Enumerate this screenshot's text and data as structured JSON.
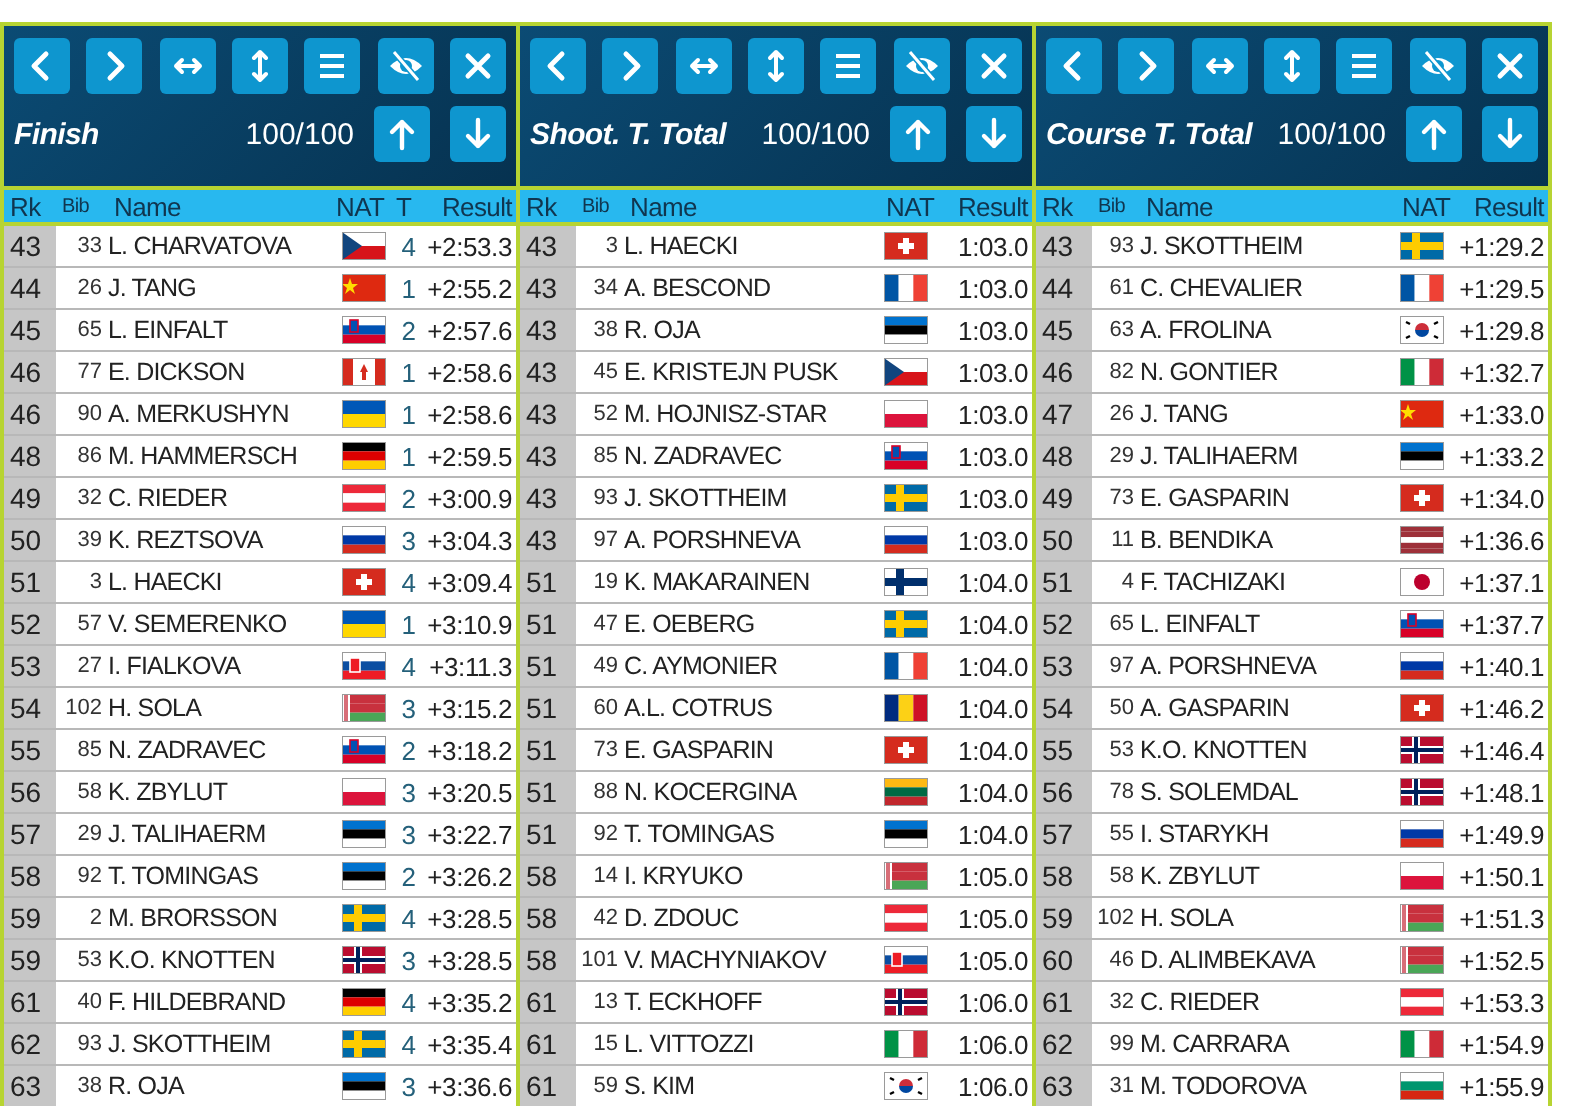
{
  "panels": [
    {
      "title": "Finish",
      "count": "100/100",
      "columns": [
        "Rk",
        "Bib",
        "Name",
        "NAT",
        "T",
        "Result"
      ],
      "rows": [
        {
          "rank": "43",
          "bib": "33",
          "name": "L. CHARVATOVA",
          "kind": "cze",
          "shots": "4",
          "result": "+2:53.3"
        },
        {
          "rank": "44",
          "bib": "26",
          "name": "J. TANG",
          "kind": "chn",
          "shots": "1",
          "result": "+2:55.2"
        },
        {
          "rank": "45",
          "bib": "65",
          "name": "L. EINFALT",
          "kind": "slo",
          "shots": "2",
          "result": "+2:57.6"
        },
        {
          "rank": "46",
          "bib": "77",
          "name": "E. DICKSON",
          "kind": "can",
          "shots": "1",
          "result": "+2:58.6"
        },
        {
          "rank": "46",
          "bib": "90",
          "name": "A. MERKUSHYN",
          "kind": "ukr",
          "shots": "1",
          "result": "+2:58.6"
        },
        {
          "rank": "48",
          "bib": "86",
          "name": "M. HAMMERSCH",
          "kind": "ger",
          "shots": "1",
          "result": "+2:59.5"
        },
        {
          "rank": "49",
          "bib": "32",
          "name": "C. RIEDER",
          "kind": "aut",
          "shots": "2",
          "result": "+3:00.9"
        },
        {
          "rank": "50",
          "bib": "39",
          "name": "K. REZTSOVA",
          "kind": "rus",
          "shots": "3",
          "result": "+3:04.3"
        },
        {
          "rank": "51",
          "bib": "3",
          "name": "L. HAECKI",
          "kind": "sui",
          "shots": "4",
          "result": "+3:09.4"
        },
        {
          "rank": "52",
          "bib": "57",
          "name": "V. SEMERENKO",
          "kind": "ukr",
          "shots": "1",
          "result": "+3:10.9"
        },
        {
          "rank": "53",
          "bib": "27",
          "name": "I. FIALKOVA",
          "kind": "svk",
          "shots": "4",
          "result": "+3:11.3"
        },
        {
          "rank": "54",
          "bib": "102",
          "name": "H. SOLA",
          "kind": "blr",
          "shots": "3",
          "result": "+3:15.2"
        },
        {
          "rank": "55",
          "bib": "85",
          "name": "N. ZADRAVEC",
          "kind": "slo",
          "shots": "2",
          "result": "+3:18.2"
        },
        {
          "rank": "56",
          "bib": "58",
          "name": "K. ZBYLUT",
          "kind": "pol",
          "shots": "3",
          "result": "+3:20.5"
        },
        {
          "rank": "57",
          "bib": "29",
          "name": "J. TALIHAERM",
          "kind": "est",
          "shots": "3",
          "result": "+3:22.7"
        },
        {
          "rank": "58",
          "bib": "92",
          "name": "T. TOMINGAS",
          "kind": "est",
          "shots": "2",
          "result": "+3:26.2"
        },
        {
          "rank": "59",
          "bib": "2",
          "name": "M. BRORSSON",
          "kind": "swe",
          "shots": "4",
          "result": "+3:28.5"
        },
        {
          "rank": "59",
          "bib": "53",
          "name": "K.O. KNOTTEN",
          "kind": "nor",
          "shots": "3",
          "result": "+3:28.5"
        },
        {
          "rank": "61",
          "bib": "40",
          "name": "F. HILDEBRAND",
          "kind": "ger",
          "shots": "4",
          "result": "+3:35.2"
        },
        {
          "rank": "62",
          "bib": "93",
          "name": "J. SKOTTHEIM",
          "kind": "swe",
          "shots": "4",
          "result": "+3:35.4"
        },
        {
          "rank": "63",
          "bib": "38",
          "name": "R. OJA",
          "kind": "est",
          "shots": "3",
          "result": "+3:36.6"
        }
      ]
    },
    {
      "title": "Shoot. T. Total",
      "count": "100/100",
      "columns": [
        "Rk",
        "Bib",
        "Name",
        "NAT",
        "Result"
      ],
      "rows": [
        {
          "rank": "43",
          "bib": "3",
          "name": "L. HAECKI",
          "kind": "sui",
          "result": "1:03.0"
        },
        {
          "rank": "43",
          "bib": "34",
          "name": "A. BESCOND",
          "kind": "fra",
          "result": "1:03.0"
        },
        {
          "rank": "43",
          "bib": "38",
          "name": "R. OJA",
          "kind": "est",
          "result": "1:03.0"
        },
        {
          "rank": "43",
          "bib": "45",
          "name": "E. KRISTEJN PUSK",
          "kind": "cze",
          "result": "1:03.0"
        },
        {
          "rank": "43",
          "bib": "52",
          "name": "M. HOJNISZ-STAR",
          "kind": "pol",
          "result": "1:03.0"
        },
        {
          "rank": "43",
          "bib": "85",
          "name": "N. ZADRAVEC",
          "kind": "slo",
          "result": "1:03.0"
        },
        {
          "rank": "43",
          "bib": "93",
          "name": "J. SKOTTHEIM",
          "kind": "swe",
          "result": "1:03.0"
        },
        {
          "rank": "43",
          "bib": "97",
          "name": "A. PORSHNEVA",
          "kind": "rus",
          "result": "1:03.0"
        },
        {
          "rank": "51",
          "bib": "19",
          "name": "K. MAKARAINEN",
          "kind": "fin",
          "result": "1:04.0"
        },
        {
          "rank": "51",
          "bib": "47",
          "name": "E. OEBERG",
          "kind": "swe",
          "result": "1:04.0"
        },
        {
          "rank": "51",
          "bib": "49",
          "name": "C. AYMONIER",
          "kind": "fra",
          "result": "1:04.0"
        },
        {
          "rank": "51",
          "bib": "60",
          "name": "A.L. COTRUS",
          "kind": "rou",
          "result": "1:04.0"
        },
        {
          "rank": "51",
          "bib": "73",
          "name": "E. GASPARIN",
          "kind": "sui",
          "result": "1:04.0"
        },
        {
          "rank": "51",
          "bib": "88",
          "name": "N. KOCERGINA",
          "kind": "ltu",
          "result": "1:04.0"
        },
        {
          "rank": "51",
          "bib": "92",
          "name": "T. TOMINGAS",
          "kind": "est",
          "result": "1:04.0"
        },
        {
          "rank": "58",
          "bib": "14",
          "name": "I. KRYUKO",
          "kind": "blr",
          "result": "1:05.0"
        },
        {
          "rank": "58",
          "bib": "42",
          "name": "D. ZDOUC",
          "kind": "aut",
          "result": "1:05.0"
        },
        {
          "rank": "58",
          "bib": "101",
          "name": "V. MACHYNIAKOV",
          "kind": "svk",
          "result": "1:05.0"
        },
        {
          "rank": "61",
          "bib": "13",
          "name": "T. ECKHOFF",
          "kind": "nor",
          "result": "1:06.0"
        },
        {
          "rank": "61",
          "bib": "15",
          "name": "L. VITTOZZI",
          "kind": "ita",
          "result": "1:06.0"
        },
        {
          "rank": "61",
          "bib": "59",
          "name": "S. KIM",
          "kind": "kor",
          "result": "1:06.0"
        }
      ]
    },
    {
      "title": "Course T. Total",
      "count": "100/100",
      "columns": [
        "Rk",
        "Bib",
        "Name",
        "NAT",
        "Result"
      ],
      "rows": [
        {
          "rank": "43",
          "bib": "93",
          "name": "J. SKOTTHEIM",
          "kind": "swe",
          "result": "+1:29.2"
        },
        {
          "rank": "44",
          "bib": "61",
          "name": "C. CHEVALIER",
          "kind": "fra",
          "result": "+1:29.5"
        },
        {
          "rank": "45",
          "bib": "63",
          "name": "A. FROLINA",
          "kind": "kor",
          "result": "+1:29.8"
        },
        {
          "rank": "46",
          "bib": "82",
          "name": "N. GONTIER",
          "kind": "ita",
          "result": "+1:32.7"
        },
        {
          "rank": "47",
          "bib": "26",
          "name": "J. TANG",
          "kind": "chn",
          "result": "+1:33.0"
        },
        {
          "rank": "48",
          "bib": "29",
          "name": "J. TALIHAERM",
          "kind": "est",
          "result": "+1:33.2"
        },
        {
          "rank": "49",
          "bib": "73",
          "name": "E. GASPARIN",
          "kind": "sui",
          "result": "+1:34.0"
        },
        {
          "rank": "50",
          "bib": "11",
          "name": "B. BENDIKA",
          "kind": "lat",
          "result": "+1:36.6"
        },
        {
          "rank": "51",
          "bib": "4",
          "name": "F. TACHIZAKI",
          "kind": "jpn",
          "result": "+1:37.1"
        },
        {
          "rank": "52",
          "bib": "65",
          "name": "L. EINFALT",
          "kind": "slo",
          "result": "+1:37.7"
        },
        {
          "rank": "53",
          "bib": "97",
          "name": "A. PORSHNEVA",
          "kind": "rus",
          "result": "+1:40.1"
        },
        {
          "rank": "54",
          "bib": "50",
          "name": "A. GASPARIN",
          "kind": "sui",
          "result": "+1:46.2"
        },
        {
          "rank": "55",
          "bib": "53",
          "name": "K.O. KNOTTEN",
          "kind": "nor",
          "result": "+1:46.4"
        },
        {
          "rank": "56",
          "bib": "78",
          "name": "S. SOLEMDAL",
          "kind": "nor",
          "result": "+1:48.1"
        },
        {
          "rank": "57",
          "bib": "55",
          "name": "I. STARYKH",
          "kind": "rus",
          "result": "+1:49.9"
        },
        {
          "rank": "58",
          "bib": "58",
          "name": "K. ZBYLUT",
          "kind": "pol",
          "result": "+1:50.1"
        },
        {
          "rank": "59",
          "bib": "102",
          "name": "H. SOLA",
          "kind": "blr",
          "result": "+1:51.3"
        },
        {
          "rank": "60",
          "bib": "46",
          "name": "D. ALIMBEKAVA",
          "kind": "blr",
          "result": "+1:52.5"
        },
        {
          "rank": "61",
          "bib": "32",
          "name": "C. RIEDER",
          "kind": "aut",
          "result": "+1:53.3"
        },
        {
          "rank": "62",
          "bib": "99",
          "name": "M. CARRARA",
          "kind": "ita",
          "result": "+1:54.9"
        },
        {
          "rank": "63",
          "bib": "31",
          "name": "M. TODOROVA",
          "kind": "bul",
          "result": "+1:55.9"
        }
      ]
    }
  ]
}
